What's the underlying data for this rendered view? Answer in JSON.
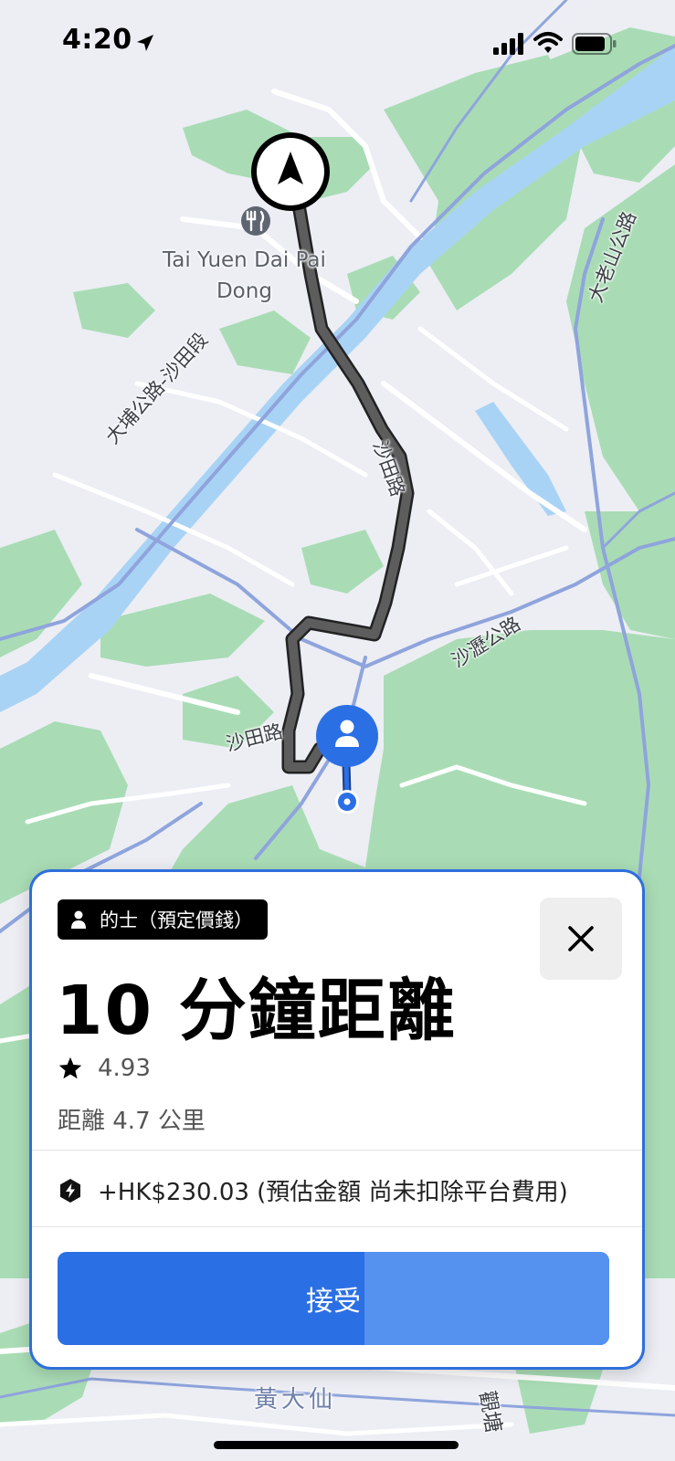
{
  "status_bar": {
    "time": "4:20",
    "icons": [
      "location-arrow-icon",
      "cellular-signal-icon",
      "wifi-icon",
      "battery-icon"
    ]
  },
  "map": {
    "poi_label": "Tai Yuen Dai Pai\nDong",
    "poi_icon": "restaurant-icon",
    "road_labels": {
      "tai_po_road": "大埔公路-沙田段",
      "sha_tin_road_a": "沙田路",
      "sha_tin_road_b": "沙田路",
      "sha_lek_highway": "沙瀝公路",
      "tai_lo_shan_road": "大老山公路",
      "wong_tai_sin": "黃大仙",
      "kwun_tong": "觀塘"
    },
    "driver_marker_icon": "navigation-arrow-icon",
    "rider_marker_icon": "person-icon"
  },
  "trip_card": {
    "type_label": "的士（預定價錢）",
    "type_icon": "person-icon",
    "headline": "10 分鐘距離",
    "rating": "4.93",
    "distance": "距離 4.7 公里",
    "fare": "+HK$230.03 (預估金額 尚未扣除平台費用)",
    "fare_icon": "lightning-bolt-icon",
    "accept_label": "接受",
    "accept_progress": 0.44,
    "close_icon": "close-icon"
  },
  "colors": {
    "accent_blue": "#2b6fe4",
    "card_border": "#2e6fdd",
    "route": "#545454",
    "water": "#a9d3f5",
    "park": "#a8dbb4"
  }
}
